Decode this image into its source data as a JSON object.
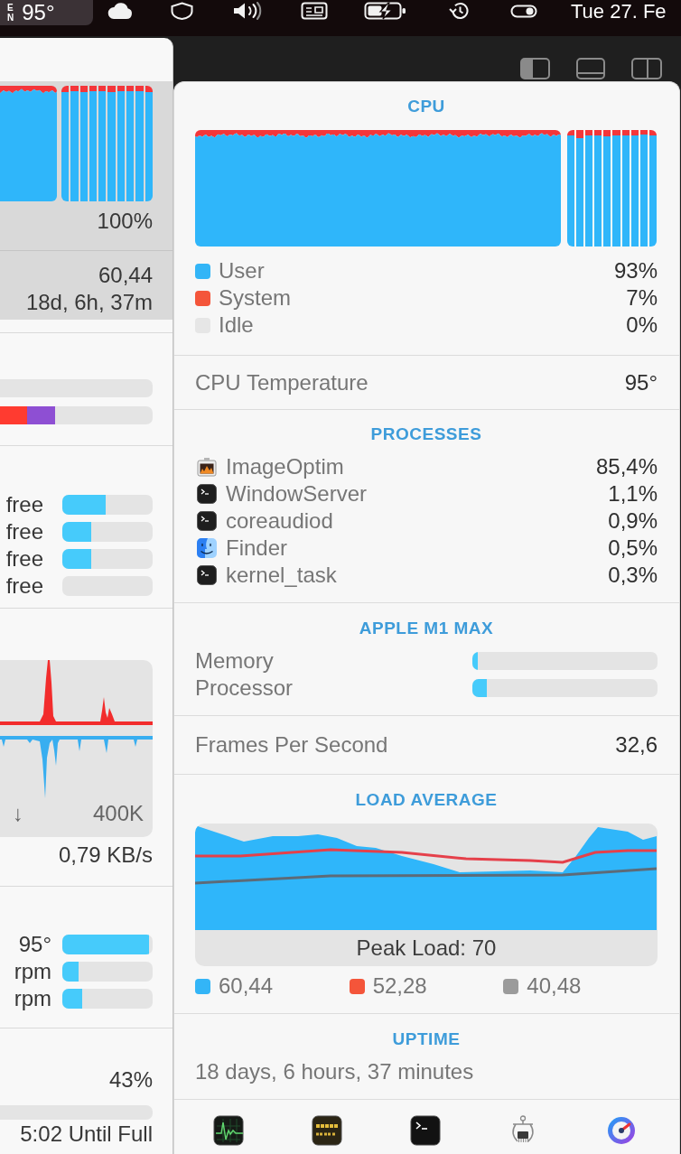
{
  "menu_bar": {
    "sensor_letters": [
      "E",
      "N"
    ],
    "temperature": "95°",
    "clock": "Tue 27. Fe"
  },
  "background_panel": {
    "cpu": {
      "highlighted": true,
      "usage": "100%",
      "load": "60,44",
      "uptime": "18d, 6h, 37m"
    },
    "memory_bars": [
      {
        "kind": "track"
      },
      {
        "kind": "stacked",
        "segments": [
          {
            "level": 0.18,
            "color": "#ff3b30"
          },
          {
            "level": 0.18,
            "color": "#8e4fd3"
          }
        ]
      }
    ],
    "disks": [
      {
        "label": "free",
        "level": 0.48
      },
      {
        "label": "free",
        "level": 0.32
      },
      {
        "label": "free",
        "level": 0.32
      },
      {
        "label": "free"
      }
    ],
    "network": {
      "axis_label": "↓",
      "scale": "400K",
      "rate": "0,79 KB/s"
    },
    "sensors": [
      {
        "label": "95°",
        "level": 0.96
      },
      {
        "label": "rpm",
        "level": 0.18
      },
      {
        "label": "rpm",
        "level": 0.22
      }
    ],
    "battery": {
      "percent": "43%",
      "status": "5:02 Until Full"
    }
  },
  "detail_panel": {
    "cpu": {
      "title": "CPU",
      "legend": [
        {
          "label": "User",
          "value": "93%",
          "color": "#33b5f7"
        },
        {
          "label": "System",
          "value": "7%",
          "color": "#f4553a"
        },
        {
          "label": "Idle",
          "value": "0%",
          "color": "#e6e6e6"
        }
      ]
    },
    "temperature": {
      "label": "CPU Temperature",
      "value": "95°"
    },
    "processes": {
      "title": "PROCESSES",
      "items": [
        {
          "kind": "image",
          "name": "ImageOptim",
          "value": "85,4%"
        },
        {
          "kind": "terminal",
          "name": "WindowServer",
          "value": "1,1%"
        },
        {
          "kind": "terminal",
          "name": "coreaudiod",
          "value": "0,9%"
        },
        {
          "kind": "face",
          "name": "Finder",
          "value": "0,5%"
        },
        {
          "kind": "terminal",
          "name": "kernel_task",
          "value": "0,3%"
        }
      ]
    },
    "gpu": {
      "title": "APPLE M1 MAX",
      "meters": [
        {
          "label": "Memory",
          "level": 0.03
        },
        {
          "label": "Processor",
          "level": 0.08
        }
      ]
    },
    "fps": {
      "label": "Frames Per Second",
      "value": "32,6"
    },
    "load_average": {
      "title": "LOAD AVERAGE",
      "caption": "Peak Load: 70",
      "legend": [
        {
          "value": "60,44",
          "color": "#33b5f7"
        },
        {
          "value": "52,28",
          "color": "#f4553a"
        },
        {
          "value": "40,48",
          "color": "#9b9b9b"
        }
      ]
    },
    "uptime": {
      "title": "UPTIME",
      "value": "18 days, 6 hours, 37 minutes"
    }
  }
}
